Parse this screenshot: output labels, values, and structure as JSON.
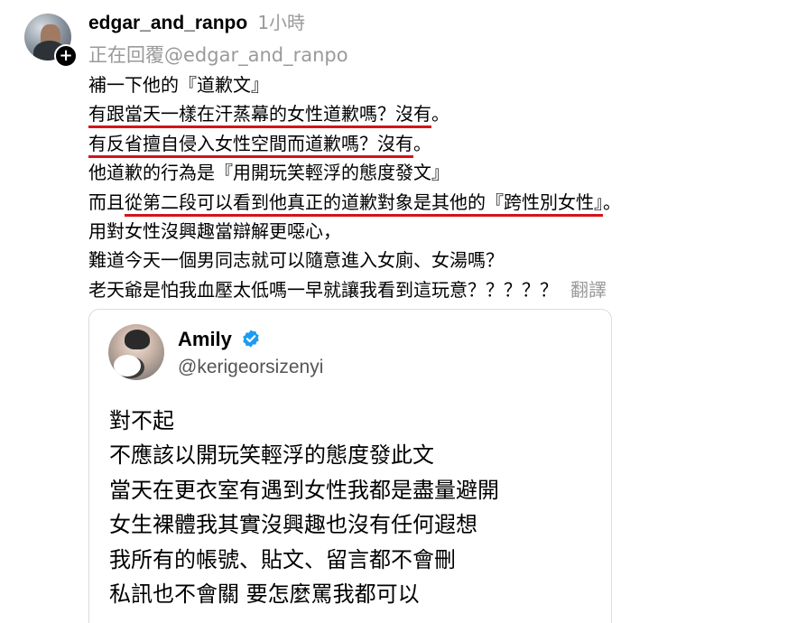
{
  "post": {
    "username": "edgar_and_ranpo",
    "time": "1小時",
    "reply_prefix": "正在回覆",
    "reply_handle": "@edgar_and_ranpo",
    "lines": [
      {
        "before": "補一下他的『道歉文』",
        "underlined": "",
        "after": ""
      },
      {
        "before": "",
        "underlined": "有跟當天一樣在汗蒸幕的女性道歉嗎？沒有",
        "after": "。"
      },
      {
        "before": "",
        "underlined": "有反省擅自侵入女性空間而道歉嗎？沒有",
        "after": "。"
      },
      {
        "before": "他道歉的行為是『用開玩笑輕浮的態度發文』",
        "underlined": "",
        "after": ""
      },
      {
        "before": "而且",
        "underlined": "從第二段可以看到他真正的道歉對象是其他的『跨性別女性』",
        "after": "。"
      },
      {
        "before": "用對女性沒興趣當辯解更噁心，",
        "underlined": "",
        "after": ""
      },
      {
        "before": "難道今天一個男同志就可以隨意進入女廁、女湯嗎？",
        "underlined": "",
        "after": ""
      },
      {
        "before": "老天爺是怕我血壓太低嗎一早就讓我看到這玩意？？？？？",
        "underlined": "",
        "after": ""
      }
    ],
    "translate_label": "翻譯"
  },
  "quote": {
    "name": "Amily",
    "handle": "@kerigeorsizenyi",
    "lines": [
      "對不起",
      "不應該以開玩笑輕浮的態度發此文",
      "當天在更衣室有遇到女性我都是盡量避開",
      "女生裸體我其實沒興趣也沒有任何遐想",
      "我所有的帳號、貼文、留言都不會刪",
      "私訊也不會關 要怎麼罵我都可以"
    ]
  },
  "icons": {
    "follow_badge": "plus-icon",
    "verified": "verified-badge-icon"
  },
  "colors": {
    "underline": "#d4141a",
    "muted_text": "#9a9a9a",
    "verified_blue": "#1d9bf0"
  }
}
